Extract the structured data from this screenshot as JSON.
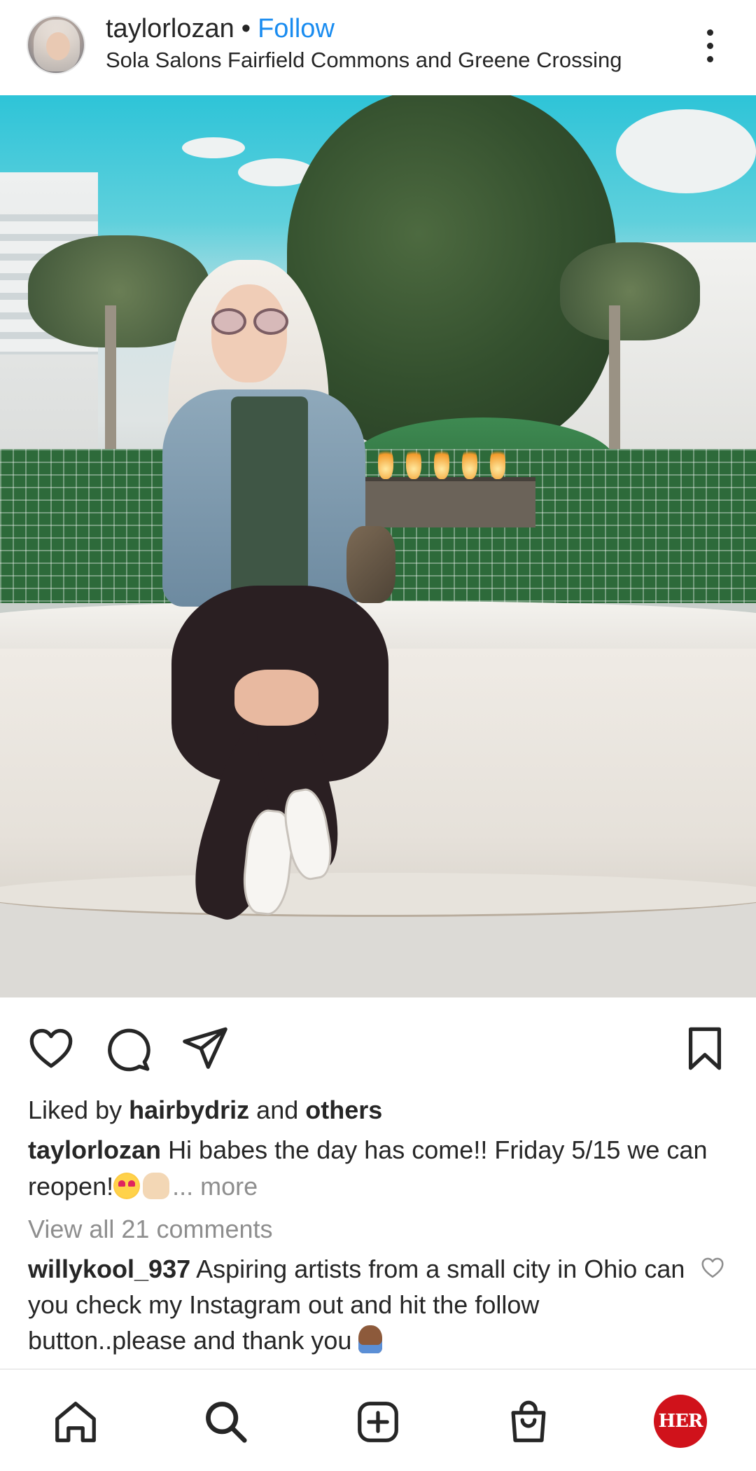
{
  "header": {
    "username": "taylorlozan",
    "separator": "•",
    "follow_label": "Follow",
    "location": "Sola Salons Fairfield Commons and Greene Crossing",
    "menu_icon": "more-vertical-icon"
  },
  "photo": {
    "icon": "post-photo"
  },
  "actions": {
    "like_icon": "heart-icon",
    "comment_icon": "comment-icon",
    "share_icon": "send-icon",
    "save_icon": "bookmark-icon"
  },
  "likes": {
    "prefix": "Liked by",
    "user": "hairbydriz",
    "conj": "and",
    "others": "others"
  },
  "caption": {
    "username": "taylorlozan",
    "text": "Hi babes the day has come!! Friday 5/15 we can reopen!",
    "more": "... more"
  },
  "comments": {
    "view_all": "View all 21 comments",
    "top_comment": {
      "username": "willykool_937",
      "text": "Aspiring artists from a small city in Ohio can you check my Instagram out and hit the follow button..please and thank you"
    }
  },
  "nav": {
    "items": [
      "home-icon",
      "search-icon",
      "create-icon",
      "shop-icon",
      "profile-avatar"
    ],
    "profile_badge_text": "HER"
  },
  "colors": {
    "follow_blue": "#1a8cf0",
    "text": "#262626",
    "muted": "#8e8e8e",
    "profile_badge": "#d0121b"
  }
}
